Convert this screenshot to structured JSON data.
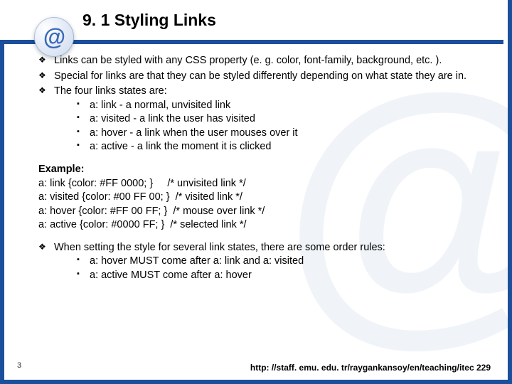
{
  "title": "9. 1 Styling Links",
  "bullets1": [
    "Links can be styled with any CSS property (e. g. color, font-family, background, etc. ).",
    "Special for links are that they can be styled differently depending on what state they are in.",
    "The four links states are:"
  ],
  "states": [
    "a: link - a normal, unvisited link",
    "a: visited - a link the user has visited",
    "a: hover - a link when the user mouses over it",
    "a: active - a link the moment it is clicked"
  ],
  "example_label": "Example:",
  "example_lines": [
    "a: link {color: #FF 0000; }     /* unvisited link */",
    "a: visited {color: #00 FF 00; }  /* visited link */",
    "a: hover {color: #FF 00 FF; }  /* mouse over link */",
    "a: active {color: #0000 FF; }  /* selected link */"
  ],
  "bullets2": [
    "When setting the style for several link states, there are some order rules:"
  ],
  "rules": [
    "a: hover MUST come after a: link and a: visited",
    "a: active MUST come after a: hover"
  ],
  "page_num": "3",
  "footer_url": "http: //staff. emu. edu. tr/raygankansoy/en/teaching/itec 229"
}
